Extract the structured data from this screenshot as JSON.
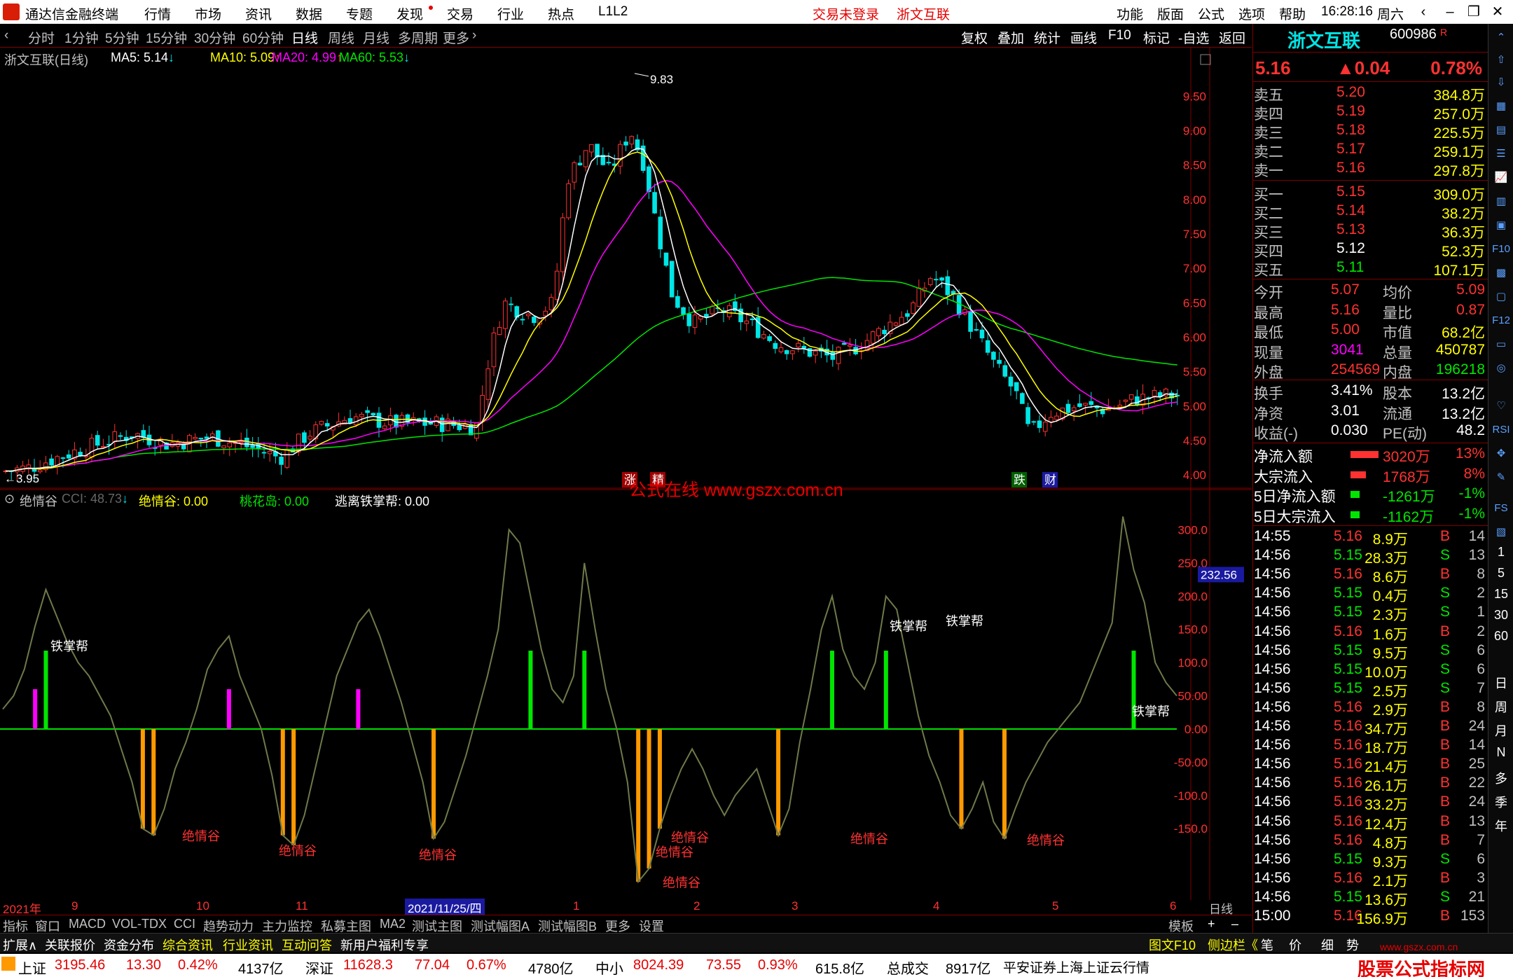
{
  "titlebar": {
    "app_title": "通达信金融终端",
    "menus": [
      "行情",
      "市场",
      "资讯",
      "数据",
      "专题",
      "发现",
      "交易",
      "行业",
      "热点",
      "L1L2"
    ],
    "login_status": "交易未登录",
    "stock_name": "浙文互联",
    "right_menus": [
      "功能",
      "版面",
      "公式",
      "选项",
      "帮助"
    ],
    "time": "16:28:16",
    "weekday": "周六"
  },
  "toolbar": {
    "periods": [
      "分时",
      "1分钟",
      "5分钟",
      "15分钟",
      "30分钟",
      "60分钟",
      "日线",
      "周线",
      "月线",
      "多周期",
      "更多"
    ],
    "active_period": "日线",
    "buttons": [
      "复权",
      "叠加",
      "统计",
      "画线",
      "F10",
      "标记",
      "-自选",
      "返回"
    ]
  },
  "main_chart": {
    "title": "浙文互联(日线)",
    "ma5_label": "MA5: 5.14",
    "ma10_label": "MA10: 5.09",
    "ma20_label": "MA20: 4.99",
    "ma60_label": "MA60: 5.53",
    "high_mark": "9.83",
    "low_mark": "3.95",
    "badges": [
      "涨",
      "精",
      "跌",
      "财"
    ],
    "price_ticks": [
      "9.50",
      "9.00",
      "8.50",
      "8.00",
      "7.50",
      "7.00",
      "6.50",
      "6.00",
      "5.50",
      "5.00",
      "4.50",
      "4.00"
    ],
    "colors": {
      "up": "#ff3232",
      "down": "#00e5e5",
      "ma5": "#ffffff",
      "ma10": "#ffff00",
      "ma20": "#ff00ff",
      "ma60": "#00e600"
    }
  },
  "watermark": "公式在线 www.gszx.com.cn",
  "indicator": {
    "name": "绝情谷",
    "cci_label": "CCI: 48.73",
    "jqg_label": "绝情谷: 0.00",
    "thd_label": "桃花岛: 0.00",
    "tzb_label": "逃离铁掌帮: 0.00",
    "current_value": "232.56",
    "ticks": [
      "300.0",
      "250.0",
      "200.0",
      "150.0",
      "100.0",
      "50.00",
      "0.00",
      "-50.00",
      "-100.0",
      "-150.0"
    ],
    "signal_tie": "铁掌帮",
    "signal_jue": "绝情谷"
  },
  "date_axis": [
    "2021年",
    "9",
    "10",
    "11",
    "2021/11/25/四",
    "1",
    "2",
    "3",
    "4",
    "5",
    "6"
  ],
  "period_label": "日线",
  "indicator_tabs": [
    "指标",
    "窗口",
    "MACD",
    "VOL-TDX",
    "CCI",
    "趋势动力",
    "主力监控",
    "私募主图",
    "MA2",
    "测试主图",
    "测试幅图A",
    "测试幅图B",
    "更多",
    "设置"
  ],
  "template_label": "模板",
  "info_tabs": [
    "扩展∧",
    "关联报价",
    "资金分布",
    "综合资讯",
    "行业资讯",
    "互动问答",
    "新用户福利专享"
  ],
  "info_right": [
    "图文F10",
    "侧边栏《",
    "笔",
    "价",
    "细",
    "势"
  ],
  "index_bar": {
    "sh_name": "上证",
    "sh_val": "3195.46",
    "sh_chg": "13.30",
    "sh_pct": "0.42%",
    "sh_amt": "4137亿",
    "sz_name": "深证",
    "sz_val": "11628.3",
    "sz_chg": "77.04",
    "sz_pct": "0.67%",
    "sz_amt": "4780亿",
    "zx_name": "中小",
    "zx_val": "8024.39",
    "zx_chg": "73.55",
    "zx_pct": "0.93%",
    "zx_amt": "615.8亿",
    "total_label": "总成交",
    "total_val": "8917亿",
    "broker": "平安证券上海上证云行情"
  },
  "brand_watermark": "股票公式指标网",
  "brand_url": "www.gszx.com.cn",
  "quote": {
    "name": "浙文互联",
    "code": "600986",
    "tag": "R",
    "price": "5.16",
    "change": "▲0.04",
    "pct": "0.78%",
    "asks": [
      {
        "label": "卖五",
        "price": "5.20",
        "vol": "384.8万"
      },
      {
        "label": "卖四",
        "price": "5.19",
        "vol": "257.0万"
      },
      {
        "label": "卖三",
        "price": "5.18",
        "vol": "225.5万"
      },
      {
        "label": "卖二",
        "price": "5.17",
        "vol": "259.1万"
      },
      {
        "label": "卖一",
        "price": "5.16",
        "vol": "297.8万"
      }
    ],
    "bids": [
      {
        "label": "买一",
        "price": "5.15",
        "vol": "309.0万"
      },
      {
        "label": "买二",
        "price": "5.14",
        "vol": "38.2万"
      },
      {
        "label": "买三",
        "price": "5.13",
        "vol": "36.3万"
      },
      {
        "label": "买四",
        "price": "5.12",
        "vol": "52.3万"
      },
      {
        "label": "买五",
        "price": "5.11",
        "vol": "107.1万"
      }
    ],
    "stats": [
      {
        "l1": "今开",
        "v1": "5.07",
        "l2": "均价",
        "v2": "5.09"
      },
      {
        "l1": "最高",
        "v1": "5.16",
        "l2": "量比",
        "v2": "0.87"
      },
      {
        "l1": "最低",
        "v1": "5.00",
        "l2": "市值",
        "v2": "68.2亿"
      },
      {
        "l1": "现量",
        "v1": "3041",
        "l2": "总量",
        "v2": "450787"
      },
      {
        "l1": "外盘",
        "v1": "254569",
        "l2": "内盘",
        "v2": "196218"
      }
    ],
    "stats2": [
      {
        "l1": "换手",
        "v1": "3.41%",
        "l2": "股本",
        "v2": "13.2亿"
      },
      {
        "l1": "净资",
        "v1": "3.01",
        "l2": "流通",
        "v2": "13.2亿"
      },
      {
        "l1": "收益(-)",
        "v1": "0.030",
        "l2": "PE(动)",
        "v2": "48.2"
      }
    ],
    "flows": [
      {
        "label": "净流入额",
        "val": "3020万",
        "pct": "13%",
        "bar": 0.9,
        "color": "#ff3232"
      },
      {
        "label": "大宗流入",
        "val": "1768万",
        "pct": "8%",
        "bar": 0.5,
        "color": "#ff3232"
      },
      {
        "label": "5日净流入额",
        "val": "-1261万",
        "pct": "-1%",
        "bar": 0.3,
        "color": "#00e600"
      },
      {
        "label": "5日大宗流入",
        "val": "-1162万",
        "pct": "-1%",
        "bar": 0.3,
        "color": "#00e600"
      }
    ],
    "ticks": [
      {
        "t": "14:55",
        "p": "5.16",
        "v": "8.9万",
        "bs": "B",
        "n": "14"
      },
      {
        "t": "14:56",
        "p": "5.15",
        "v": "28.3万",
        "bs": "S",
        "n": "13"
      },
      {
        "t": "14:56",
        "p": "5.16",
        "v": "8.6万",
        "bs": "B",
        "n": "8"
      },
      {
        "t": "14:56",
        "p": "5.15",
        "v": "0.4万",
        "bs": "S",
        "n": "2"
      },
      {
        "t": "14:56",
        "p": "5.15",
        "v": "2.3万",
        "bs": "S",
        "n": "1"
      },
      {
        "t": "14:56",
        "p": "5.16",
        "v": "1.6万",
        "bs": "B",
        "n": "2"
      },
      {
        "t": "14:56",
        "p": "5.15",
        "v": "9.5万",
        "bs": "S",
        "n": "6"
      },
      {
        "t": "14:56",
        "p": "5.15",
        "v": "10.0万",
        "bs": "S",
        "n": "6"
      },
      {
        "t": "14:56",
        "p": "5.15",
        "v": "2.5万",
        "bs": "S",
        "n": "7"
      },
      {
        "t": "14:56",
        "p": "5.16",
        "v": "2.9万",
        "bs": "B",
        "n": "8"
      },
      {
        "t": "14:56",
        "p": "5.16",
        "v": "34.7万",
        "bs": "B",
        "n": "24"
      },
      {
        "t": "14:56",
        "p": "5.16",
        "v": "18.7万",
        "bs": "B",
        "n": "14"
      },
      {
        "t": "14:56",
        "p": "5.16",
        "v": "21.4万",
        "bs": "B",
        "n": "25"
      },
      {
        "t": "14:56",
        "p": "5.16",
        "v": "26.1万",
        "bs": "B",
        "n": "22"
      },
      {
        "t": "14:56",
        "p": "5.16",
        "v": "33.2万",
        "bs": "B",
        "n": "24"
      },
      {
        "t": "14:56",
        "p": "5.16",
        "v": "12.4万",
        "bs": "B",
        "n": "13"
      },
      {
        "t": "14:56",
        "p": "5.16",
        "v": "4.8万",
        "bs": "B",
        "n": "7"
      },
      {
        "t": "14:56",
        "p": "5.15",
        "v": "9.3万",
        "bs": "S",
        "n": "6"
      },
      {
        "t": "14:56",
        "p": "5.16",
        "v": "2.1万",
        "bs": "B",
        "n": "3"
      },
      {
        "t": "14:56",
        "p": "5.15",
        "v": "13.6万",
        "bs": "S",
        "n": "21"
      },
      {
        "t": "15:00",
        "p": "5.16",
        "v": "156.9万",
        "bs": "B",
        "n": "153"
      }
    ]
  },
  "rightbar_texts": [
    "日",
    "周",
    "月",
    "N",
    "多",
    "季",
    "年"
  ],
  "rightbar_nums": [
    "5",
    "15",
    "30",
    "60"
  ],
  "chart_data": {
    "type": "candlestick",
    "candles": [],
    "ma5_last": 5.14,
    "ma10_last": 5.09,
    "ma20_last": 4.99,
    "ma60_last": 5.53,
    "high": 9.83,
    "low": 3.95,
    "y_range": [
      3.9,
      9.9
    ],
    "indicator_series": [
      30,
      50,
      90,
      155,
      210,
      170,
      130,
      100,
      80,
      50,
      20,
      -30,
      -80,
      -150,
      -160,
      -120,
      -60,
      -20,
      30,
      90,
      120,
      140,
      80,
      40,
      0,
      -70,
      -160,
      -175,
      -130,
      -60,
      10,
      80,
      120,
      160,
      180,
      140,
      90,
      40,
      -20,
      -80,
      -165,
      -140,
      -90,
      -40,
      20,
      80,
      150,
      300,
      280,
      200,
      120,
      60,
      40,
      80,
      250,
      150,
      60,
      0,
      -80,
      -230,
      -210,
      -150,
      -100,
      -60,
      -30,
      -60,
      -100,
      -130,
      -100,
      -80,
      -60,
      -110,
      -160,
      -120,
      -20,
      60,
      150,
      200,
      120,
      80,
      60,
      100,
      200,
      180,
      100,
      20,
      -40,
      -80,
      -130,
      -150,
      -120,
      -80,
      -140,
      -165,
      -120,
      -80,
      -50,
      -20,
      0,
      20,
      40,
      80,
      120,
      160,
      320,
      240,
      190,
      100,
      70,
      50
    ],
    "ylim_indicator": [
      -250,
      330
    ]
  }
}
